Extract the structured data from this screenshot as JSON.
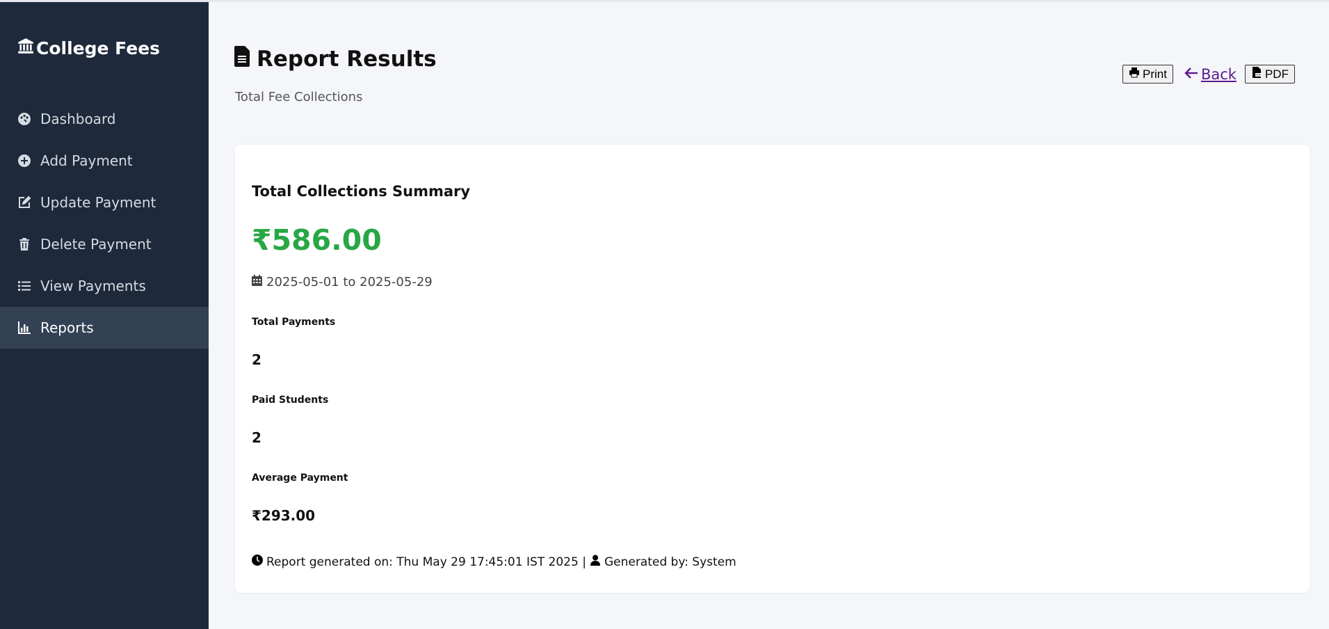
{
  "sidebar": {
    "brand": "College Fees",
    "items": [
      {
        "label": "Dashboard",
        "icon": "palette-icon"
      },
      {
        "label": "Add Payment",
        "icon": "plus-circle-icon"
      },
      {
        "label": "Update Payment",
        "icon": "edit-icon"
      },
      {
        "label": "Delete Payment",
        "icon": "trash-icon"
      },
      {
        "label": "View Payments",
        "icon": "list-icon"
      },
      {
        "label": "Reports",
        "icon": "chart-icon"
      }
    ],
    "active_item": "Reports"
  },
  "header": {
    "title": "Report Results",
    "subtitle": "Total Fee Collections"
  },
  "actions": {
    "print_label": "Print",
    "back_label": " Back ",
    "pdf_label": "PDF"
  },
  "summary": {
    "title": "Total Collections Summary",
    "total_amount": "₹586.00",
    "date_range": "2025-05-01 to 2025-05-29",
    "stats": [
      {
        "label": "Total Payments",
        "value": "2"
      },
      {
        "label": "Paid Students",
        "value": "2"
      },
      {
        "label": "Average Payment",
        "value": "₹293.00"
      }
    ],
    "footer_generated": "Report generated on: Thu May 29 17:45:01 IST 2025 |",
    "footer_by": "Generated by: System"
  },
  "colors": {
    "sidebar_bg": "#1e293b",
    "sidebar_active_bg": "#334155",
    "amount_green": "#28a745",
    "link_purple": "#5b1a8c",
    "page_bg": "#f4f6f9"
  }
}
